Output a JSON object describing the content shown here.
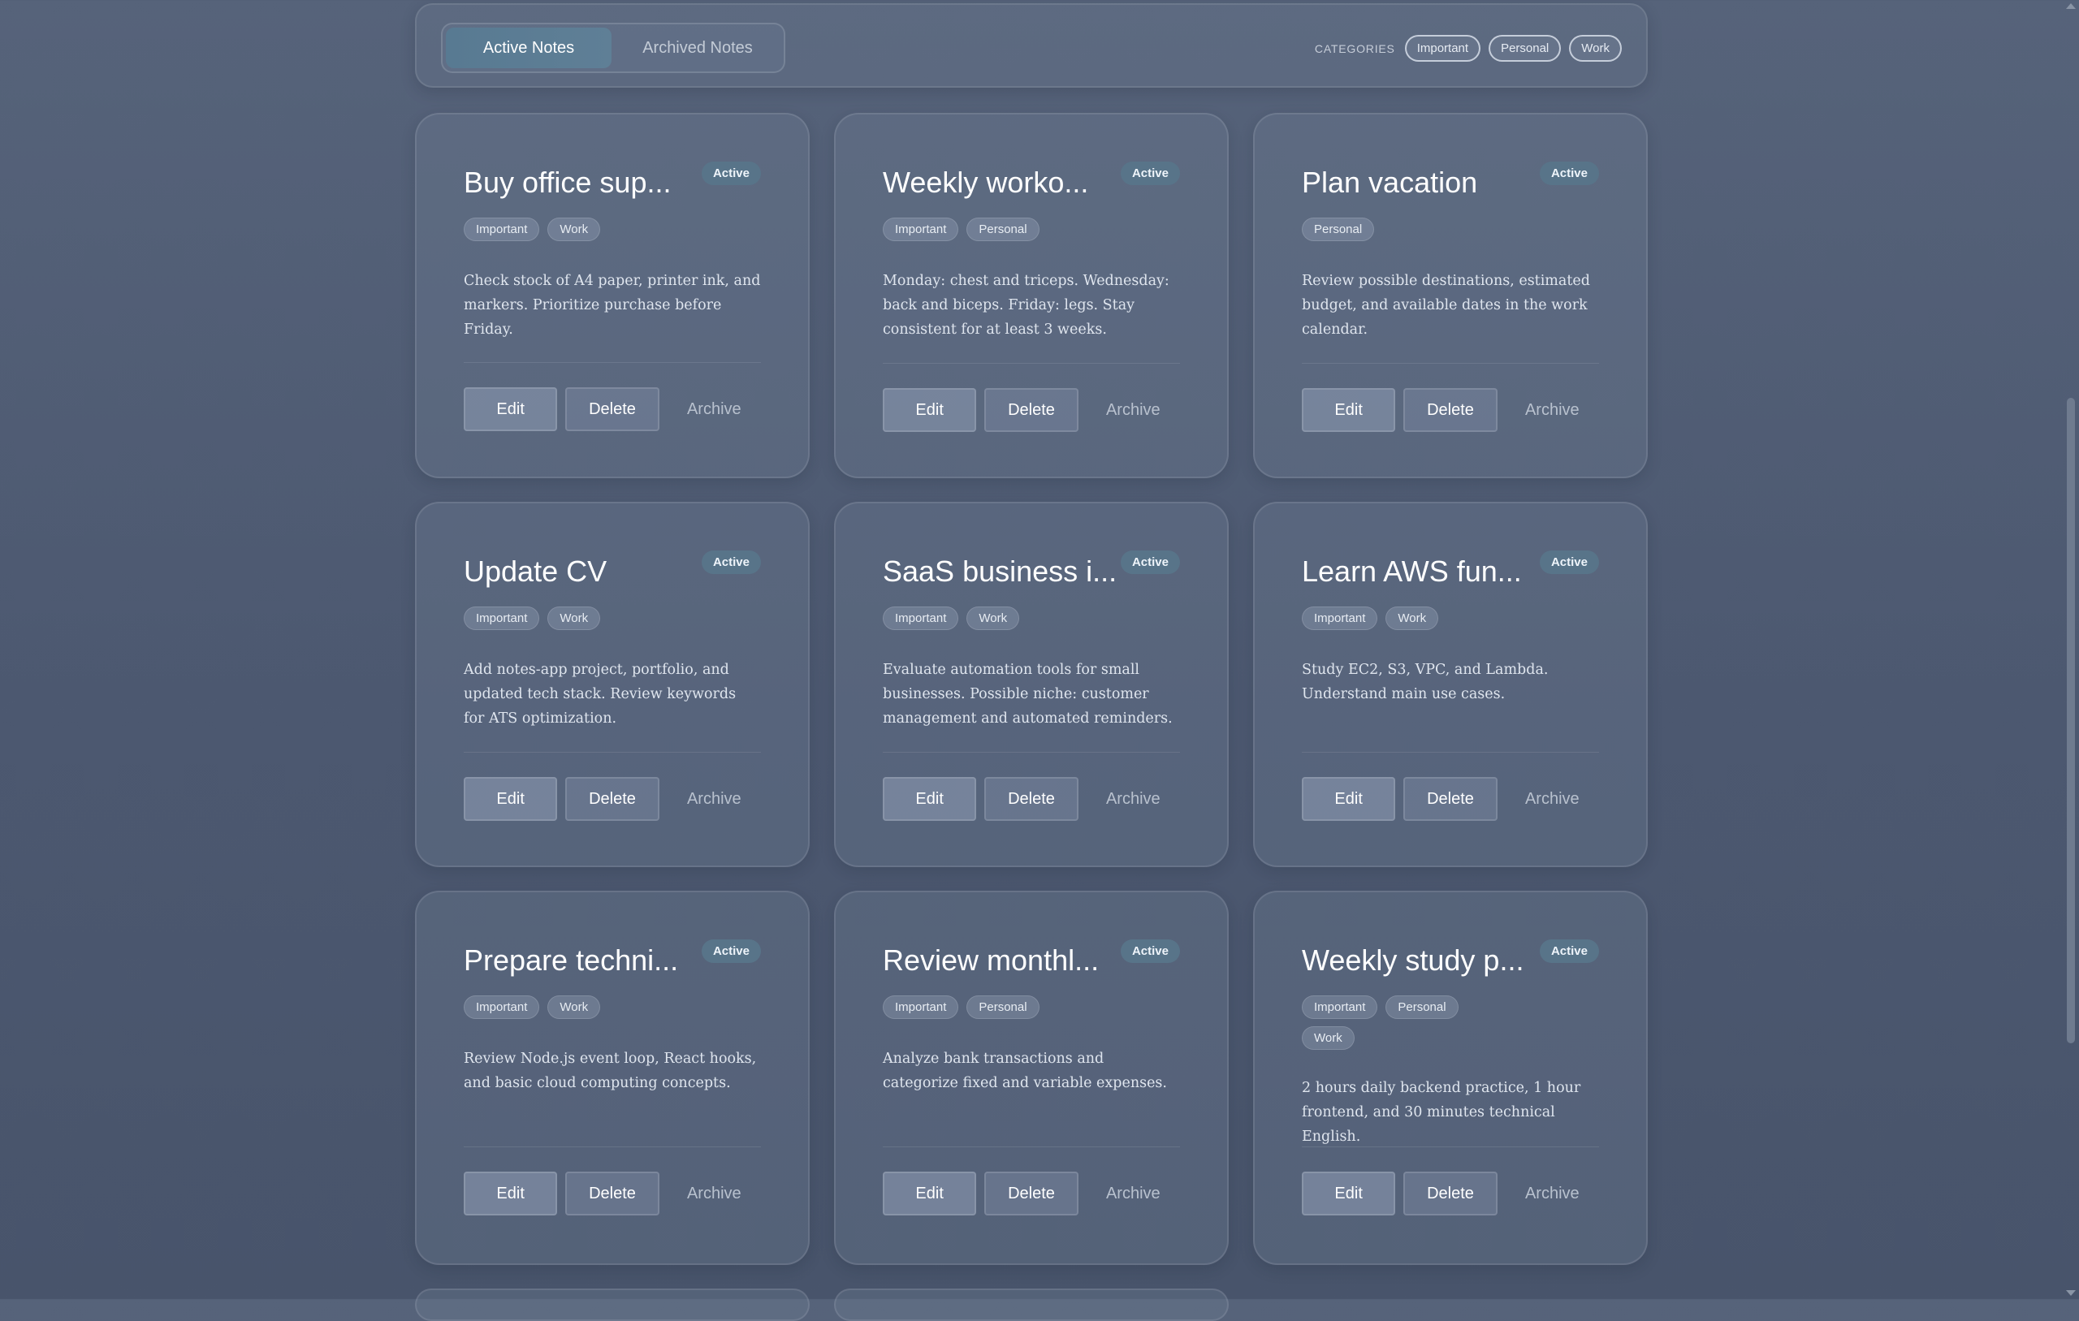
{
  "tabs": [
    {
      "label": "Active Notes",
      "active": true
    },
    {
      "label": "Archived Notes",
      "active": false
    }
  ],
  "categories": {
    "label": "CATEGORIES",
    "items": [
      "Important",
      "Personal",
      "Work"
    ]
  },
  "actions": {
    "edit": "Edit",
    "delete": "Delete",
    "archive": "Archive"
  },
  "notes": [
    {
      "title": "Buy office sup...",
      "status": "Active",
      "tags": [
        "Important",
        "Work"
      ],
      "body": "Check stock of A4 paper, printer ink, and markers. Prioritize purchase before Friday."
    },
    {
      "title": "Weekly worko...",
      "status": "Active",
      "tags": [
        "Important",
        "Personal"
      ],
      "body": "Monday: chest and triceps. Wednesday: back and biceps. Friday: legs. Stay consistent for at least 3 weeks."
    },
    {
      "title": "Plan vacation",
      "status": "Active",
      "tags": [
        "Personal"
      ],
      "body": "Review possible destinations, estimated budget, and available dates in the work calendar."
    },
    {
      "title": "Update CV",
      "status": "Active",
      "tags": [
        "Important",
        "Work"
      ],
      "body": "Add notes-app project, portfolio, and updated tech stack. Review keywords for ATS optimization."
    },
    {
      "title": "SaaS business i...",
      "status": "Active",
      "tags": [
        "Important",
        "Work"
      ],
      "body": "Evaluate automation tools for small businesses. Possible niche: customer management and automated reminders."
    },
    {
      "title": "Learn AWS fun...",
      "status": "Active",
      "tags": [
        "Important",
        "Work"
      ],
      "body": "Study EC2, S3, VPC, and Lambda. Understand main use cases."
    },
    {
      "title": "Prepare techni...",
      "status": "Active",
      "tags": [
        "Important",
        "Work"
      ],
      "body": "Review Node.js event loop, React hooks, and basic cloud computing concepts."
    },
    {
      "title": "Review monthl...",
      "status": "Active",
      "tags": [
        "Important",
        "Personal"
      ],
      "body": "Analyze bank transactions and categorize fixed and variable expenses."
    },
    {
      "title": "Weekly study p...",
      "status": "Active",
      "tags": [
        "Important",
        "Personal",
        "Work"
      ],
      "body": "2 hours daily backend practice, 1 hour frontend, and 30 minutes technical English."
    }
  ]
}
